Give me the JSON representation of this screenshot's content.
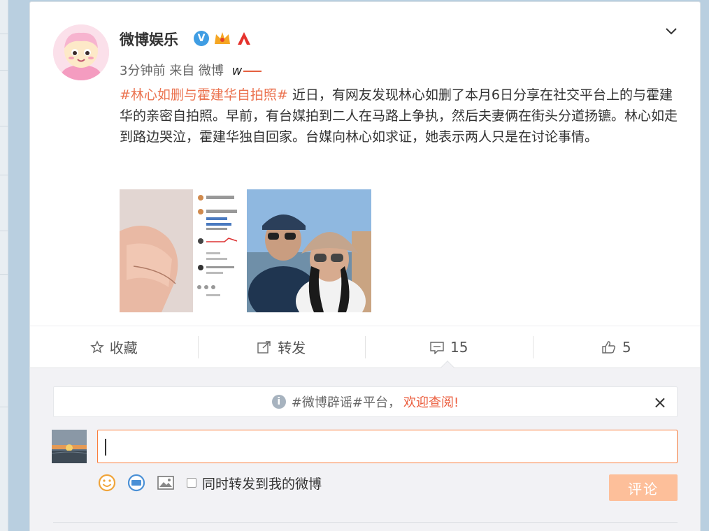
{
  "post": {
    "username": "微博娱乐",
    "meta_time": "3分钟前",
    "meta_from": "来自",
    "meta_source": "微博",
    "meta_w": "w",
    "topic": "#林心如删与霍建华自拍照#",
    "body": " 近日，有网友发现林心如删了本月6日分享在社交平台上的与霍建华的亲密自拍照。早前，有台媒拍到二人在马路上争执，然后夫妻俩在街头分道扬镳。林心如走到路边哭泣，霍建华独自回家。台媒向林心如求证，她表示两人只是在讨论事情。",
    "verified_icon": "V"
  },
  "actions": {
    "favorite": "收藏",
    "repost": "转发",
    "comment_count": "15",
    "like_count": "5"
  },
  "notice": {
    "info_icon": "i",
    "text": "#微博辟谣#平台，",
    "welcome": "欢迎查阅!",
    "close": "×"
  },
  "composer": {
    "sync_label": "同时转发到我的微博",
    "submit_label": "评论"
  },
  "colors": {
    "accent": "#eb7350",
    "input_border": "#fa7d3c",
    "submit_bg": "#fdbf9a",
    "verified": "#3f9de3"
  }
}
